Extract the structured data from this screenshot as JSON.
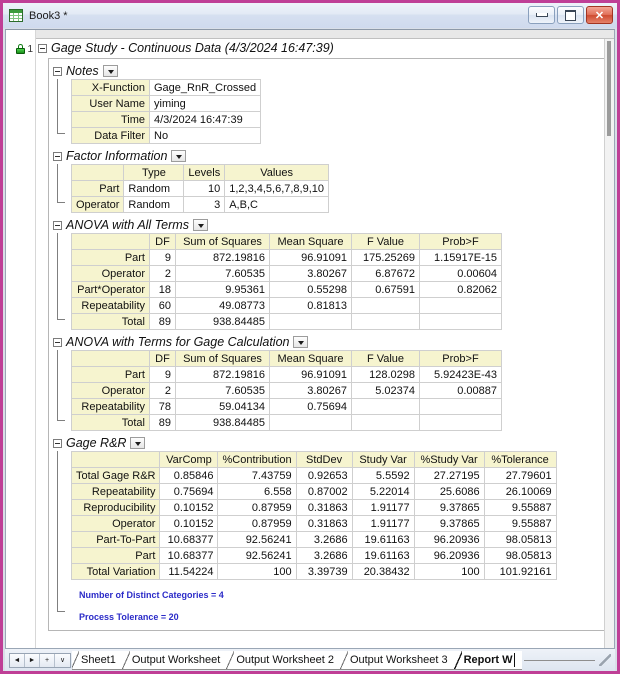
{
  "window": {
    "title": "Book3 *",
    "icon": "workbook-icon",
    "buttons": {
      "minimize": "minimize-icon",
      "maximize": "maximize-icon",
      "close": "✕"
    }
  },
  "sheet": {
    "row_number": "1",
    "lock": "lock-icon"
  },
  "report": {
    "root_title": "Gage Study - Continuous Data (4/3/2024 16:47:39)",
    "sections": [
      {
        "id": "notes",
        "title": "Notes",
        "rows": [
          {
            "label": "X-Function",
            "value": "Gage_RnR_Crossed"
          },
          {
            "label": "User Name",
            "value": "yiming"
          },
          {
            "label": "Time",
            "value": "4/3/2024 16:47:39"
          },
          {
            "label": "Data Filter",
            "value": "No"
          }
        ]
      },
      {
        "id": "factor-information",
        "title": "Factor Information",
        "headers": [
          "",
          "Type",
          "Levels",
          "Values"
        ],
        "rows": [
          {
            "label": "Part",
            "type": "Random",
            "levels": "10",
            "values": "1,2,3,4,5,6,7,8,9,10"
          },
          {
            "label": "Operator",
            "type": "Random",
            "levels": "3",
            "values": "A,B,C"
          }
        ]
      },
      {
        "id": "anova-all-terms",
        "title": "ANOVA with All Terms",
        "headers": [
          "",
          "DF",
          "Sum of Squares",
          "Mean Square",
          "F Value",
          "Prob>F"
        ],
        "rows": [
          {
            "label": "Part",
            "df": "9",
            "ss": "872.19816",
            "ms": "96.91091",
            "f": "175.25269",
            "p": "1.15917E-15"
          },
          {
            "label": "Operator",
            "df": "2",
            "ss": "7.60535",
            "ms": "3.80267",
            "f": "6.87672",
            "p": "0.00604"
          },
          {
            "label": "Part*Operator",
            "df": "18",
            "ss": "9.95361",
            "ms": "0.55298",
            "f": "0.67591",
            "p": "0.82062"
          },
          {
            "label": "Repeatability",
            "df": "60",
            "ss": "49.08773",
            "ms": "0.81813",
            "f": "",
            "p": ""
          },
          {
            "label": "Total",
            "df": "89",
            "ss": "938.84485",
            "ms": "",
            "f": "",
            "p": ""
          }
        ]
      },
      {
        "id": "anova-gage-calculation",
        "title": "ANOVA with Terms for Gage Calculation",
        "headers": [
          "",
          "DF",
          "Sum of Squares",
          "Mean Square",
          "F Value",
          "Prob>F"
        ],
        "rows": [
          {
            "label": "Part",
            "df": "9",
            "ss": "872.19816",
            "ms": "96.91091",
            "f": "128.0298",
            "p": "5.92423E-43"
          },
          {
            "label": "Operator",
            "df": "2",
            "ss": "7.60535",
            "ms": "3.80267",
            "f": "5.02374",
            "p": "0.00887"
          },
          {
            "label": "Repeatability",
            "df": "78",
            "ss": "59.04134",
            "ms": "0.75694",
            "f": "",
            "p": ""
          },
          {
            "label": "Total",
            "df": "89",
            "ss": "938.84485",
            "ms": "",
            "f": "",
            "p": ""
          }
        ]
      },
      {
        "id": "gage-rr",
        "title": "Gage R&R",
        "headers": [
          "",
          "VarComp",
          "%Contribution",
          "StdDev",
          "Study Var",
          "%Study Var",
          "%Tolerance"
        ],
        "rows": [
          {
            "label": "Total Gage R&R",
            "varcomp": "0.85846",
            "contrib": "7.43759",
            "stddev": "0.92653",
            "studyvar": "5.5592",
            "pstudyvar": "27.27195",
            "ptol": "27.79601"
          },
          {
            "label": "Repeatability",
            "varcomp": "0.75694",
            "contrib": "6.558",
            "stddev": "0.87002",
            "studyvar": "5.22014",
            "pstudyvar": "25.6086",
            "ptol": "26.10069"
          },
          {
            "label": "Reproducibility",
            "varcomp": "0.10152",
            "contrib": "0.87959",
            "stddev": "0.31863",
            "studyvar": "1.91177",
            "pstudyvar": "9.37865",
            "ptol": "9.55887"
          },
          {
            "label": "Operator",
            "varcomp": "0.10152",
            "contrib": "0.87959",
            "stddev": "0.31863",
            "studyvar": "1.91177",
            "pstudyvar": "9.37865",
            "ptol": "9.55887"
          },
          {
            "label": "Part-To-Part",
            "varcomp": "10.68377",
            "contrib": "92.56241",
            "stddev": "3.2686",
            "studyvar": "19.61163",
            "pstudyvar": "96.20936",
            "ptol": "98.05813"
          },
          {
            "label": "Part",
            "varcomp": "10.68377",
            "contrib": "92.56241",
            "stddev": "3.2686",
            "studyvar": "19.61163",
            "pstudyvar": "96.20936",
            "ptol": "98.05813"
          },
          {
            "label": "Total Variation",
            "varcomp": "11.54224",
            "contrib": "100",
            "stddev": "3.39739",
            "studyvar": "20.38432",
            "pstudyvar": "100",
            "ptol": "101.92161"
          }
        ]
      }
    ],
    "footnotes": [
      "Number of Distinct Categories = 4",
      "Process Tolerance = 20"
    ]
  },
  "tabbar": {
    "nav": [
      "◄",
      "►",
      "+",
      "∨"
    ],
    "tabs": [
      {
        "label": "Sheet1",
        "active": false
      },
      {
        "label": "Output Worksheet",
        "active": false
      },
      {
        "label": "Output Worksheet 2",
        "active": false
      },
      {
        "label": "Output Worksheet 3",
        "active": false
      },
      {
        "label": "Report W",
        "active": true,
        "editing": true
      }
    ]
  },
  "colors": {
    "frame": "#bf3f96",
    "header_cell": "#f6f4cf",
    "note_text": "#2b2bc8",
    "close_button": "#cf4b30"
  }
}
